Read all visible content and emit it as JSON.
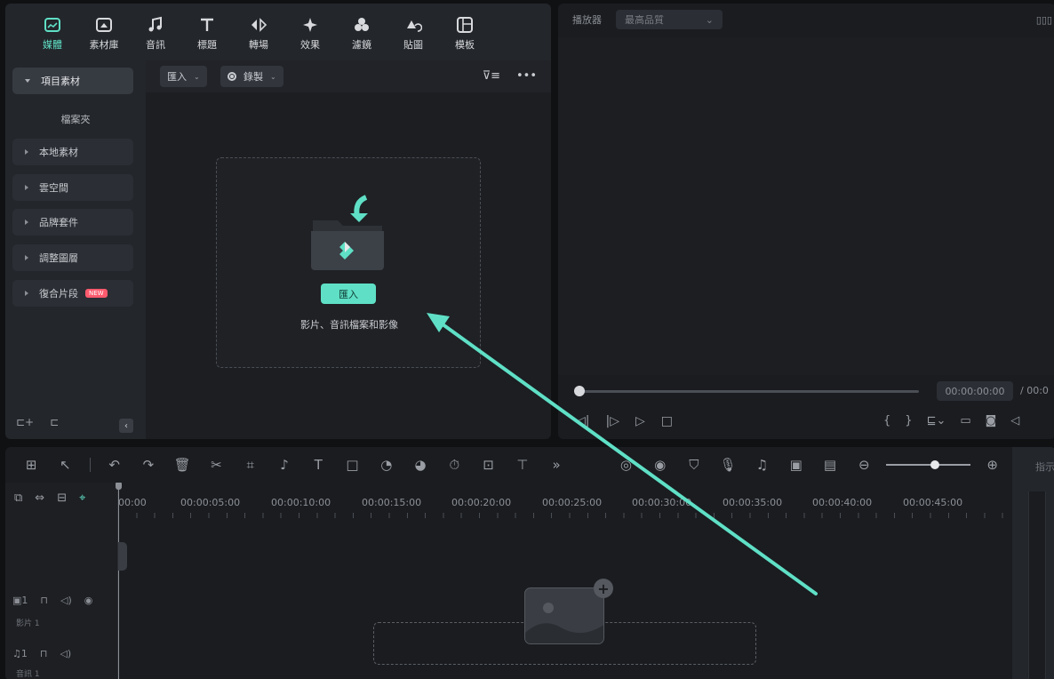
{
  "tabs": [
    {
      "label": "媒體",
      "icon": "media-icon",
      "active": true
    },
    {
      "label": "素材庫",
      "icon": "stock-library-icon"
    },
    {
      "label": "音訊",
      "icon": "music-note-icon"
    },
    {
      "label": "標題",
      "icon": "title-text-icon"
    },
    {
      "label": "轉場",
      "icon": "transition-icon"
    },
    {
      "label": "效果",
      "icon": "effects-sparkle-icon"
    },
    {
      "label": "濾鏡",
      "icon": "filter-icon"
    },
    {
      "label": "貼圖",
      "icon": "sticker-icon"
    },
    {
      "label": "模板",
      "icon": "template-icon"
    }
  ],
  "sidebar": {
    "project_media": "項目素材",
    "folder": "檔案夾",
    "local_media": "本地素材",
    "cloud": "雲空間",
    "brand_kit": "品牌套件",
    "adjustment_layer": "調整圖層",
    "compound_clip": "復合片段",
    "new_badge": "NEW"
  },
  "media_toolbar": {
    "import_label": "匯入",
    "record_label": "錄製"
  },
  "dropzone": {
    "button": "匯入",
    "hint": "影片、音訊檔案和影像"
  },
  "player": {
    "label": "播放器",
    "quality": "最高品質",
    "timecode": "00:00:00:00",
    "total": "/ 00:0"
  },
  "timeline": {
    "ruler": [
      "00:00",
      "00:00:05:00",
      "00:00:10:00",
      "00:00:15:00",
      "00:00:20:00",
      "00:00:25:00",
      "00:00:30:00",
      "00:00:35:00",
      "00:00:40:00",
      "00:00:45:00"
    ],
    "video_track_num": "1",
    "video_track_name": "影片 1",
    "audio_track_num": "1",
    "audio_track_name": "音訊 1",
    "right_dock_label": "指示"
  },
  "colors": {
    "accent": "#5fe0c6",
    "panel": "#1c1e22",
    "badge": "#ff5a6e"
  }
}
